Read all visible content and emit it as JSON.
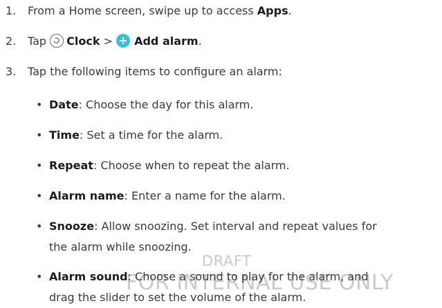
{
  "steps": [
    {
      "num": "1.",
      "text_before": "From a Home screen, swipe up to access ",
      "bold": "Apps",
      "text_after": "."
    },
    {
      "num": "2.",
      "text_before": "Tap ",
      "bold_clock": "Clock",
      "separator": " > ",
      "bold_add": "Add alarm",
      "text_after": "."
    },
    {
      "num": "3.",
      "text": "Tap the following items to configure an alarm:"
    }
  ],
  "bullets": [
    {
      "bullet": "•",
      "term": "Date",
      "desc": ": Choose the day for this alarm."
    },
    {
      "bullet": "•",
      "term": "Time",
      "desc": ": Set a time for the alarm."
    },
    {
      "bullet": "•",
      "term": "Repeat",
      "desc": ": Choose when to repeat the alarm."
    },
    {
      "bullet": "•",
      "term": "Alarm name",
      "desc": ": Enter a name for the alarm."
    },
    {
      "bullet": "•",
      "term": "Snooze",
      "desc": ": Allow snoozing. Set interval and repeat values for",
      "desc2": "the alarm while snoozing."
    },
    {
      "bullet": "•",
      "term": "Alarm sound",
      "desc": ": Choose a sound to play for the alarm, and",
      "desc2": "drag the slider to set the volume of the alarm."
    }
  ],
  "watermark": {
    "line1": "DRAFT",
    "line2": "FOR INTERNAL USE ONLY"
  },
  "icons": {
    "clock": "clock-icon",
    "add": "add-icon"
  },
  "colors": {
    "text": "#3a3a3a",
    "bold": "#1c1c1c",
    "add_icon": "#34c3d6",
    "watermark": "#c9c9c9"
  }
}
